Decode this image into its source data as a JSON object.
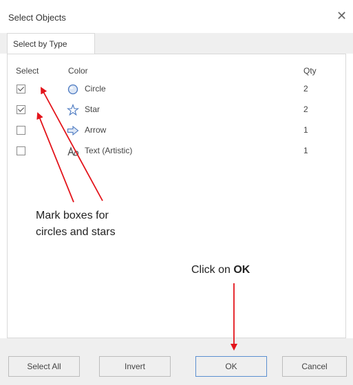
{
  "dialog": {
    "title": "Select Objects",
    "close_glyph": "✕",
    "tab": "Select by Type"
  },
  "table": {
    "headers": {
      "select": "Select",
      "color": "Color",
      "qty": "Qty"
    },
    "rows": [
      {
        "checked": true,
        "icon": "circle-icon",
        "label": "Circle",
        "qty": "2"
      },
      {
        "checked": true,
        "icon": "star-icon",
        "label": "Star",
        "qty": "2"
      },
      {
        "checked": false,
        "icon": "arrow-icon",
        "label": "Arrow",
        "qty": "1"
      },
      {
        "checked": false,
        "icon": "text-icon",
        "label": "Text (Artistic)",
        "qty": "1"
      }
    ]
  },
  "buttons": {
    "select_all": "Select All",
    "invert": "Invert",
    "ok": "OK",
    "cancel": "Cancel"
  },
  "annotations": {
    "boxes_line1": "Mark boxes for",
    "boxes_line2": "circles and stars",
    "click_prefix": "Click on ",
    "click_bold": "OK"
  },
  "colors": {
    "annotation_arrow": "#e3141b",
    "icon_blue": "#4a78c0",
    "default_button_border": "#5b8fd0"
  }
}
